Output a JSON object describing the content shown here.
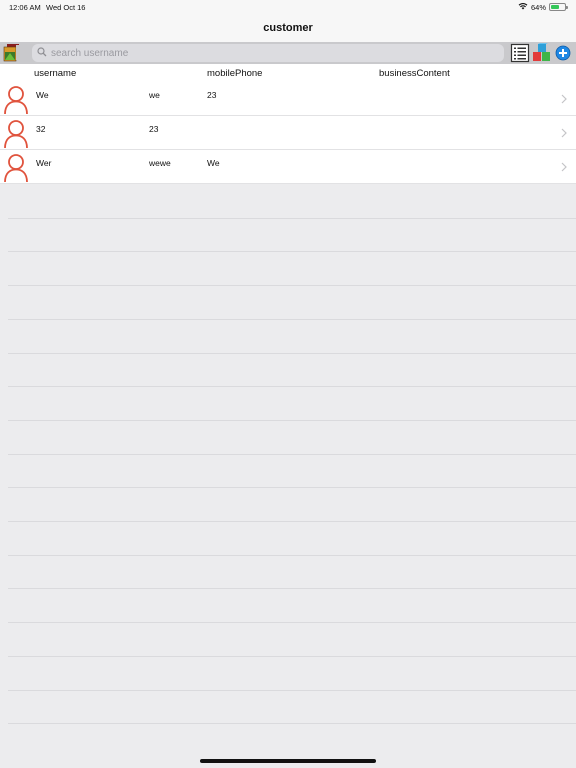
{
  "status_bar": {
    "time": "12:06 AM",
    "date": "Wed Oct 16",
    "battery_percent": "64%",
    "battery_level": 0.64
  },
  "nav": {
    "title": "customer"
  },
  "toolbar": {
    "search_placeholder": "search username",
    "icons": [
      "app-logo-icon",
      "list-view-icon",
      "cubes-icon",
      "add-icon"
    ]
  },
  "table": {
    "headers": [
      "username",
      "mobilePhone",
      "businessContent"
    ],
    "rows": [
      {
        "username": "We",
        "col2": "we",
        "col3": "23"
      },
      {
        "username": "32",
        "col2": "23",
        "col3": ""
      },
      {
        "username": "Wer",
        "col2": "wewe",
        "col3": "We"
      }
    ]
  },
  "colors": {
    "avatar": "#e0533d",
    "toolbar_bg": "#c9c9cc",
    "background": "#ececee",
    "battery": "#35c759",
    "add_button": "#1e88e5"
  }
}
